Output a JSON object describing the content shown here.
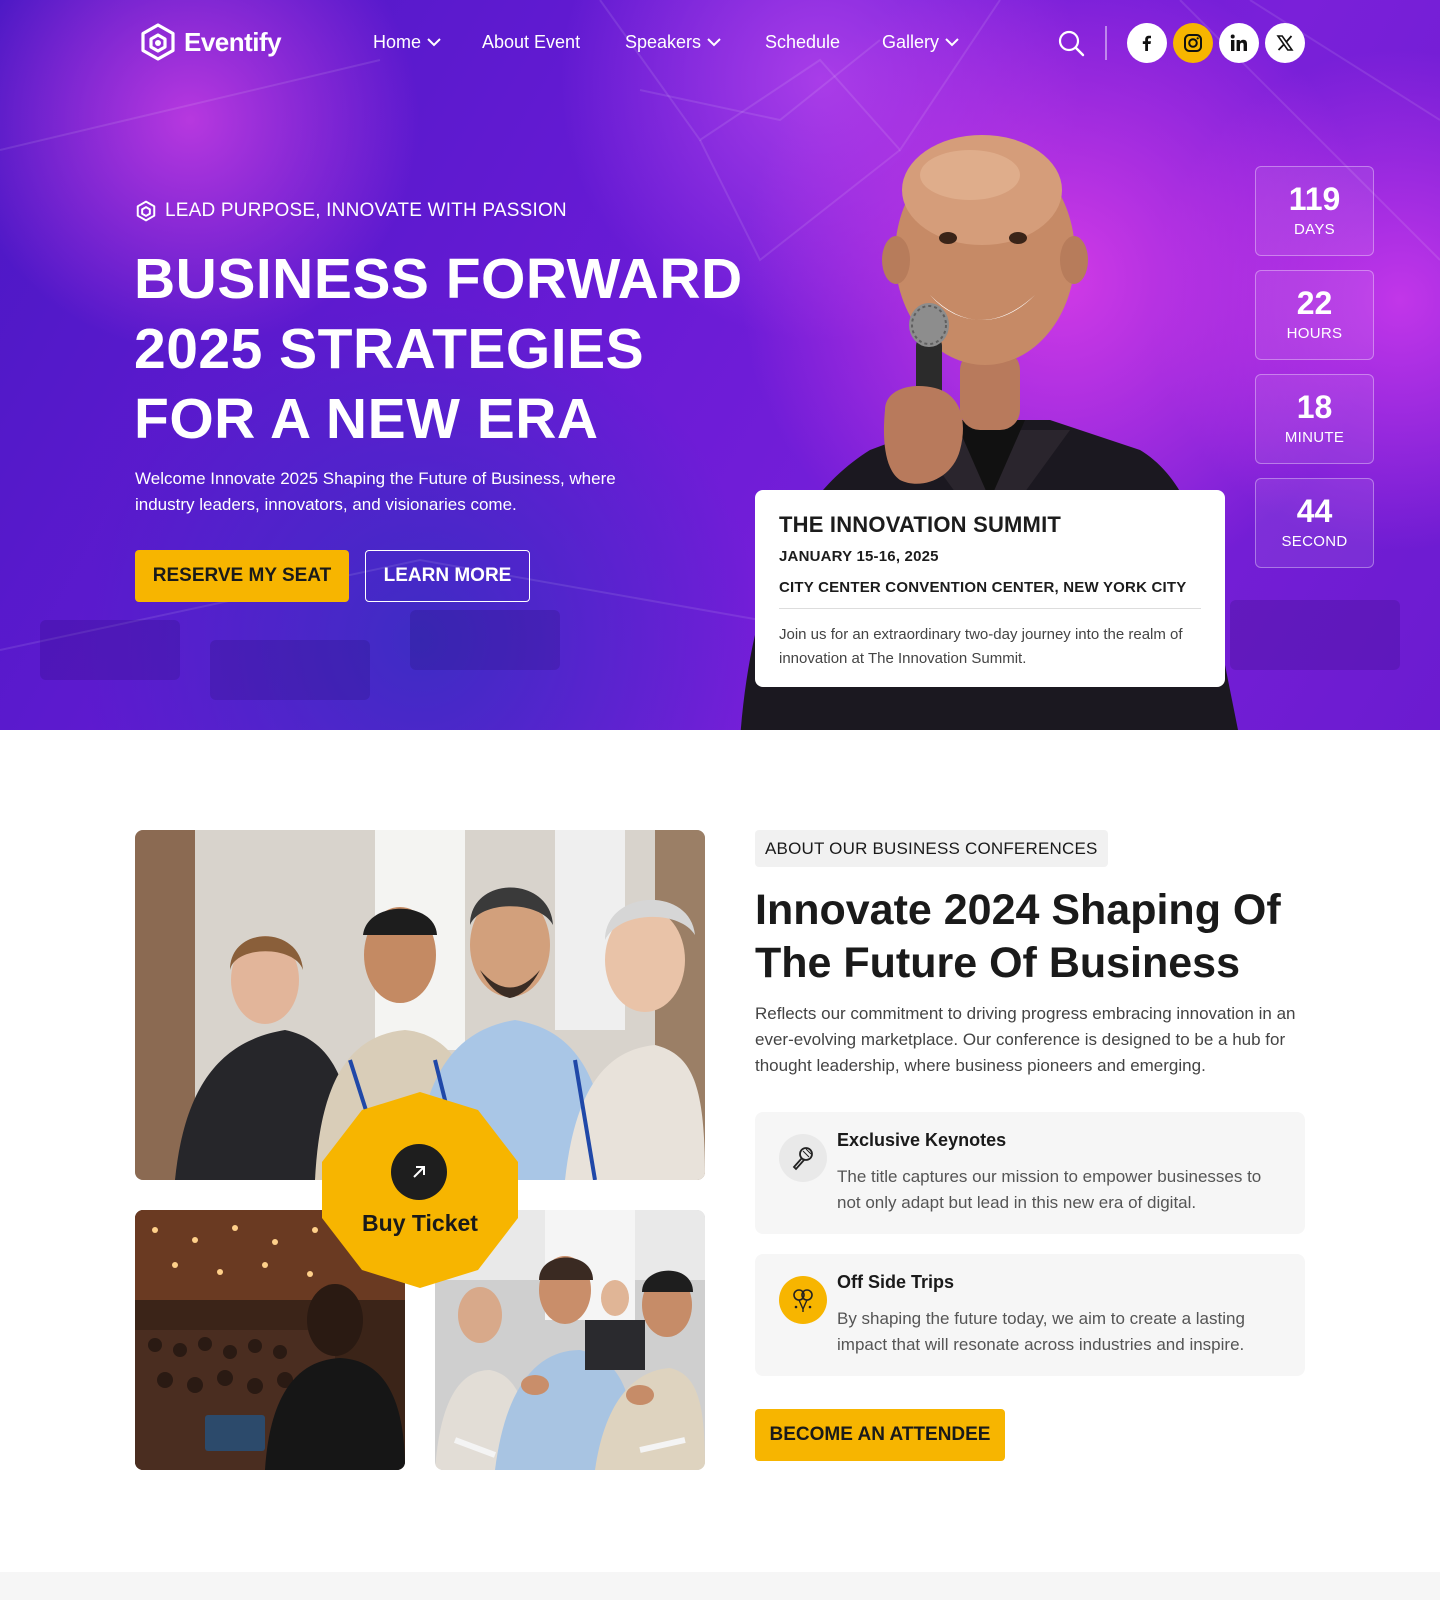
{
  "brand": {
    "name": "Eventify",
    "accent": "#f7b500",
    "hero_purple": "#6a1bd6"
  },
  "nav": {
    "items": [
      {
        "label": "Home",
        "has_dropdown": true
      },
      {
        "label": "About Event",
        "has_dropdown": false
      },
      {
        "label": "Speakers",
        "has_dropdown": true
      },
      {
        "label": "Schedule",
        "has_dropdown": false
      },
      {
        "label": "Gallery",
        "has_dropdown": true
      }
    ]
  },
  "header_icons": {
    "search": "search-icon",
    "social": [
      "facebook-icon",
      "instagram-icon",
      "linkedin-icon",
      "x-icon"
    ]
  },
  "hero": {
    "tagline": "LEAD PURPOSE, INNOVATE WITH PASSION",
    "title_lines": [
      "BUSINESS FORWARD",
      "2025 STRATEGIES",
      "FOR A NEW ERA"
    ],
    "description": "Welcome Innovate 2025 Shaping the Future of Business, where industry leaders, innovators, and visionaries come.",
    "primary_button": "RESERVE MY SEAT",
    "secondary_button": "LEARN MORE"
  },
  "countdown": [
    {
      "value": "119",
      "unit": "DAYS"
    },
    {
      "value": "22",
      "unit": "HOURS"
    },
    {
      "value": "18",
      "unit": "MINUTE"
    },
    {
      "value": "44",
      "unit": "SECOND"
    }
  ],
  "summit_card": {
    "title": "THE INNOVATION SUMMIT",
    "date": "JANUARY 15-16, 2025",
    "venue": "CITY CENTER CONVENTION CENTER, NEW YORK CITY",
    "description": "Join us for an extraordinary two-day journey into the realm of innovation at The Innovation Summit."
  },
  "about": {
    "tag": "ABOUT OUR BUSINESS CONFERENCES",
    "title_lines": [
      "Innovate 2024 Shaping Of",
      "The Future Of Business"
    ],
    "description": "Reflects our commitment to driving progress embracing innovation in an ever-evolving marketplace. Our conference is designed to be a hub for thought leadership, where business pioneers and emerging.",
    "features": [
      {
        "title": "Exclusive Keynotes",
        "description": "The title captures our mission to empower businesses to not only adapt but lead in this new era of digital.",
        "icon": "microphone-icon"
      },
      {
        "title": "Off Side Trips",
        "description": "By shaping the future today, we aim to create a lasting impact that will resonate across industries and inspire.",
        "icon": "balloons-icon"
      }
    ],
    "buy_ticket": "Buy Ticket",
    "cta_button": "BECOME AN ATTENDEE"
  }
}
